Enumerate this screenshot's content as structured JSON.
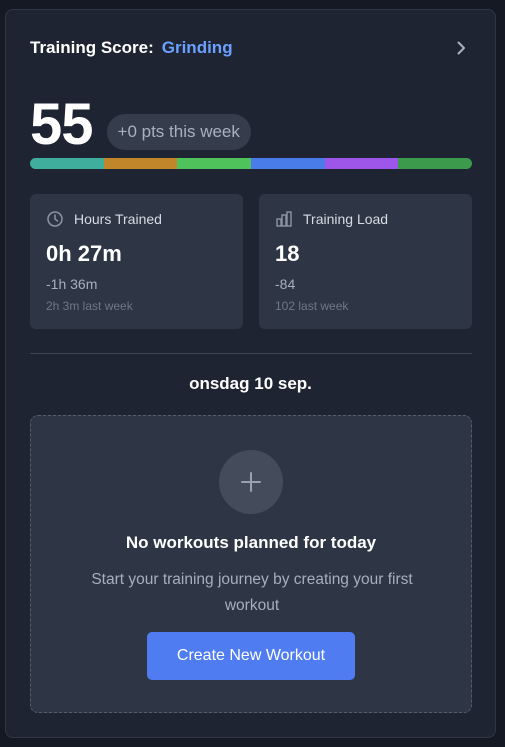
{
  "header": {
    "label": "Training Score:",
    "status": "Grinding",
    "status_color": "#6aa0ff",
    "chevron_icon": "chevron-right-icon"
  },
  "score": {
    "value": "55",
    "weekly_change": "+0 pts this week"
  },
  "progress_segments": [
    {
      "color": "#3fae9c"
    },
    {
      "color": "#c1862a"
    },
    {
      "color": "#4fc25b"
    },
    {
      "color": "#4a7ce9"
    },
    {
      "color": "#9e55ea"
    },
    {
      "color": "#3c9a4c"
    }
  ],
  "stats": {
    "hours": {
      "icon": "clock-icon",
      "title": "Hours Trained",
      "value": "0h 27m",
      "delta": "-1h 36m",
      "last_week": "2h 3m last week"
    },
    "load": {
      "icon": "bar-chart-icon",
      "title": "Training Load",
      "value": "18",
      "delta": "-84",
      "last_week": "102 last week"
    }
  },
  "date": "onsdag 10 sep.",
  "empty_state": {
    "icon": "plus-icon",
    "title": "No workouts planned for today",
    "description": "Start your training journey by creating your first workout",
    "button_label": "Create New Workout",
    "button_color": "#4f7cf0"
  }
}
